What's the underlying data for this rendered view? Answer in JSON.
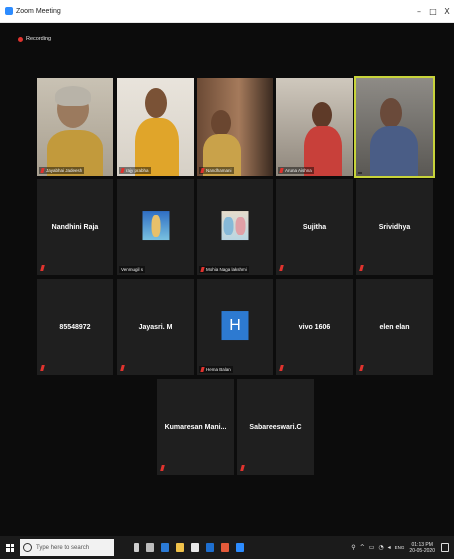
{
  "window": {
    "title": "Zoom Meeting",
    "controls": [
      "–",
      "□",
      "X"
    ]
  },
  "recording": {
    "label": "Recording"
  },
  "video_tiles": [
    {
      "label": "Jayabhai Jadeesh"
    },
    {
      "label": "rajy prabha"
    },
    {
      "label": "Nandhamani"
    },
    {
      "label": "Aruna Aishna"
    },
    {
      "label": ""
    }
  ],
  "name_tiles_row2": [
    {
      "name": "Nandhini Raja",
      "label": ""
    },
    {
      "name": "",
      "label": "Venmugil s"
    },
    {
      "name": "",
      "label": "Mohia Naga lakshmi"
    },
    {
      "name": "Sujitha",
      "label": ""
    },
    {
      "name": "Srividhya",
      "label": ""
    }
  ],
  "name_tiles_row3": [
    {
      "name": "85548972",
      "label": ""
    },
    {
      "name": "Jayasri. M",
      "label": ""
    },
    {
      "name": "",
      "label": "Hema Balan",
      "avatar_letter": "H"
    },
    {
      "name": "vivo 1606",
      "label": ""
    },
    {
      "name": "elen elan",
      "label": ""
    }
  ],
  "name_tiles_row4": [
    {
      "name": "Kumaresan Mani...",
      "label": ""
    },
    {
      "name": "Sabareeswari.C",
      "label": ""
    }
  ],
  "taskbar": {
    "search_placeholder": "Type here to search",
    "tray_lang": "ENG",
    "clock_time": "01:13 PM",
    "clock_date": "20-05-2020"
  },
  "colors": {
    "mute": "#e0332e",
    "active_speaker": "#c8d43a",
    "avatar_blue": "#2d7ad1",
    "zoom_blue": "#2d8cff"
  }
}
